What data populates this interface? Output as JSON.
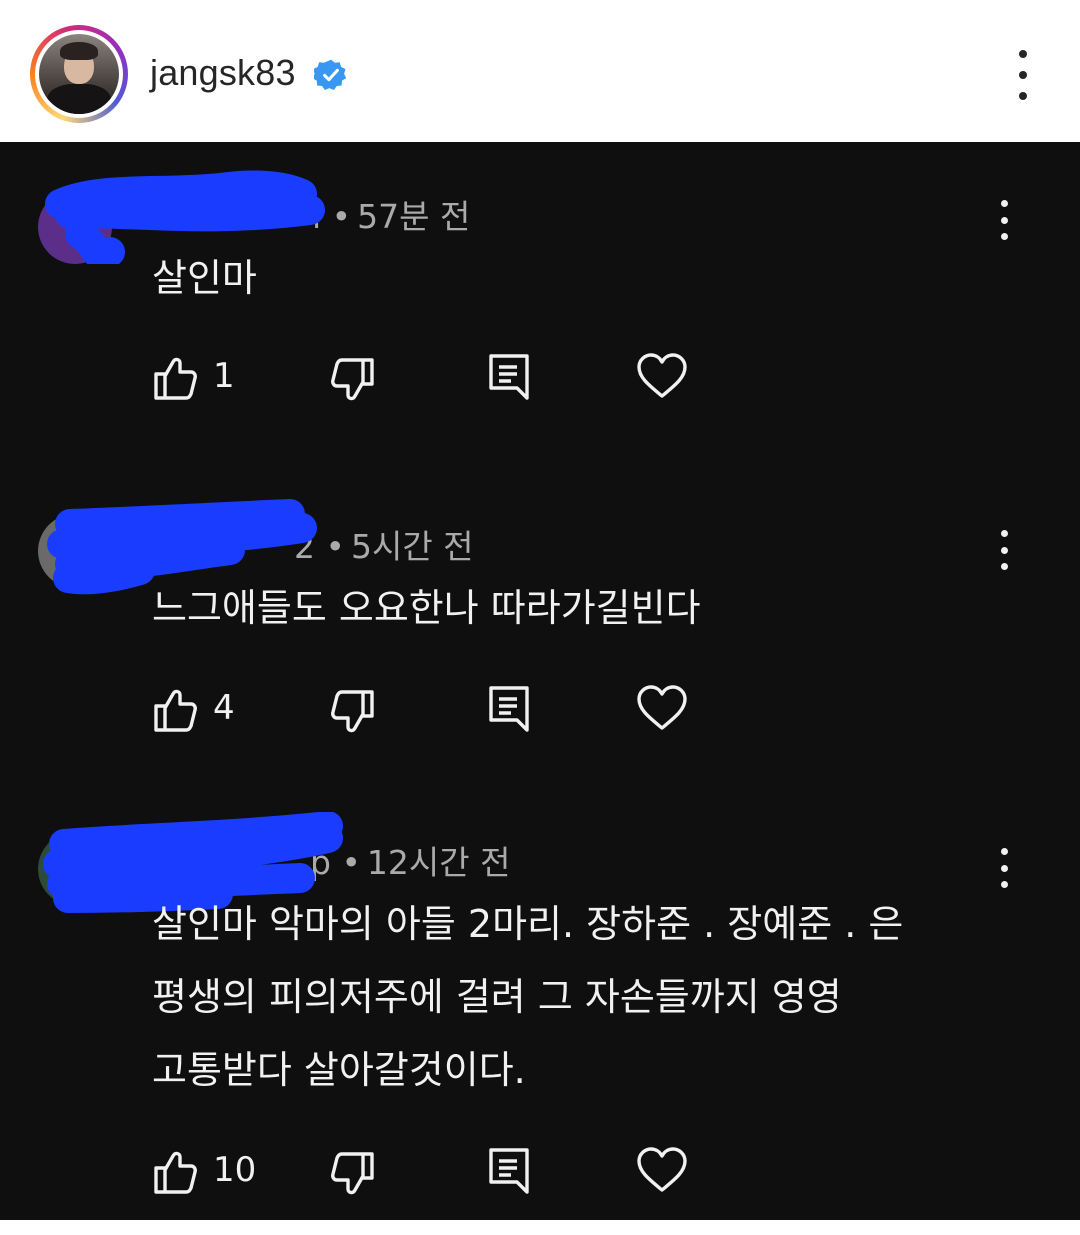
{
  "header": {
    "username": "jangsk83",
    "avatar_icon": "profile-avatar",
    "verified_icon": "verified-badge-icon",
    "more_icon": "more-vertical-icon"
  },
  "colors": {
    "background_dark": "#0f0f0f",
    "text_primary": "#f1f1f1",
    "text_secondary": "#aaaaaa",
    "verified_blue": "#3897f0",
    "redaction_blue": "#1a3cff"
  },
  "comments": [
    {
      "author_visible_fragment": "ı",
      "timestamp": "57분 전",
      "text_lines": [
        "살인마"
      ],
      "likes": "1"
    },
    {
      "author_visible_fragment": "2",
      "timestamp": "5시간 전",
      "text_lines": [
        "느그애들도 오요한나 따라가길빈다"
      ],
      "likes": "4"
    },
    {
      "author_visible_fragment": "p",
      "timestamp": "12시간 전",
      "text_lines": [
        "살인마 악마의 아들 2마리. 장하준 . 장예준 . 은",
        "평생의 피의저주에 걸려 그 자손들까지 영영",
        "고통받다 살아갈것이다."
      ],
      "likes": "10"
    }
  ],
  "action_icons": [
    "thumbs-up-icon",
    "thumbs-down-icon",
    "reply-icon",
    "heart-icon"
  ]
}
